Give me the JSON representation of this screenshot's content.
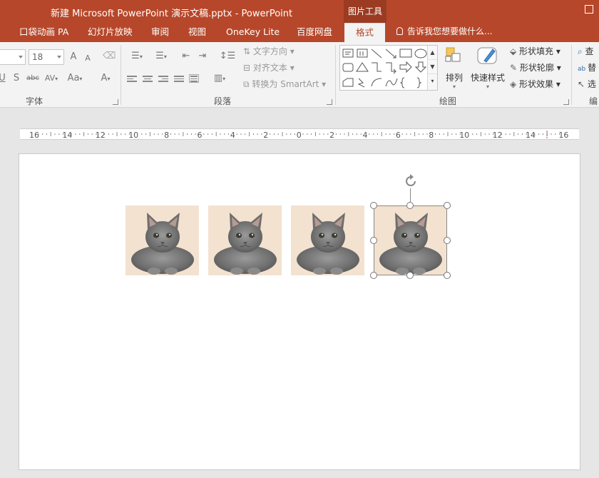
{
  "window": {
    "title": "新建 Microsoft PowerPoint 演示文稿.pptx - PowerPoint",
    "context_tab_group": "图片工具"
  },
  "tabs": [
    {
      "label": "口袋动画 PA"
    },
    {
      "label": "幻灯片放映"
    },
    {
      "label": "审阅"
    },
    {
      "label": "视图"
    },
    {
      "label": "OneKey Lite"
    },
    {
      "label": "百度网盘"
    },
    {
      "label": "格式",
      "active": true
    }
  ],
  "tell_me": "告诉我您想要做什么...",
  "ribbon": {
    "font": {
      "size_value": "18",
      "grow_label": "A",
      "shrink_label": "A",
      "strike_label": "abc",
      "spacing_label": "AV",
      "case_label": "Aa",
      "color_label": "A",
      "shadow_label": "S",
      "underline_label": "U",
      "group_label": "字体"
    },
    "paragraph": {
      "text_direction": "文字方向",
      "align_text": "对齐文本",
      "convert_smartart": "转换为 SmartArt",
      "group_label": "段落"
    },
    "drawing": {
      "arrange_label": "排列",
      "quick_styles_label": "快速样式",
      "shape_fill": "形状填充",
      "shape_outline": "形状轮廓",
      "shape_effects": "形状效果",
      "group_label": "绘图"
    },
    "editing": {
      "find_label": "查",
      "replace_label": "替",
      "select_label": "选",
      "group_label": "编"
    }
  },
  "ruler": {
    "labels": [
      "16",
      "14",
      "12",
      "10",
      "8",
      "6",
      "4",
      "2",
      "0",
      "2",
      "4",
      "6",
      "8",
      "10",
      "12",
      "14",
      "16"
    ]
  },
  "slide": {
    "images": [
      {
        "name": "cat-image-1",
        "selected": false
      },
      {
        "name": "cat-image-2",
        "selected": false
      },
      {
        "name": "cat-image-3",
        "selected": false
      },
      {
        "name": "cat-image-4",
        "selected": true
      }
    ]
  },
  "colors": {
    "accent": "#b7472a",
    "accent_dark": "#9b3b22",
    "ribbon_bg": "#f3f3f3",
    "workspace_bg": "#e6e6e6",
    "image_bg": "#f3e2d0"
  }
}
